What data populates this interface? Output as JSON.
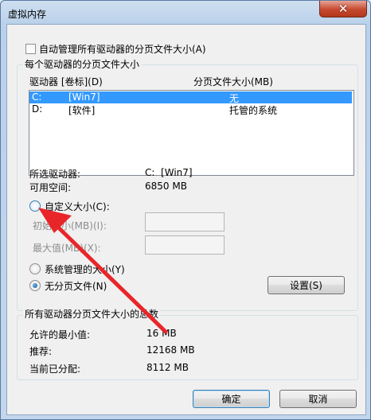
{
  "window": {
    "title": "虚拟内存",
    "close_glyph": "✕"
  },
  "auto_manage": {
    "label": "自动管理所有驱动器的分页文件大小(A)",
    "checked": false
  },
  "per_drive_group": {
    "label": "每个驱动器的分页文件大小",
    "col_drive": "驱动器 [卷标](D)",
    "col_size": "分页文件大小(MB)",
    "rows": [
      {
        "drive": "C:",
        "label": "[Win7]",
        "size": "无",
        "selected": true
      },
      {
        "drive": "D:",
        "label": "[软件]",
        "size": "托管的系统",
        "selected": false
      }
    ],
    "selected_drive_label": "所选驱动器:",
    "selected_drive_value": "C:  [Win7]",
    "free_space_label": "可用空间:",
    "free_space_value": "6850 MB",
    "custom_size_label": "自定义大小(C):",
    "initial_size_label": "初始大小(MB)(I):",
    "max_size_label": "最大值(MB)(X):",
    "system_managed_label": "系统管理的大小(Y)",
    "no_paging_label": "无分页文件(N)",
    "selected_option": "no_paging",
    "set_button": "设置(S)"
  },
  "total_group": {
    "label": "所有驱动器分页文件大小的总数",
    "min_label": "允许的最小值:",
    "min_value": "16 MB",
    "recommended_label": "推荐:",
    "recommended_value": "12168 MB",
    "allocated_label": "当前已分配:",
    "allocated_value": "8112 MB"
  },
  "buttons": {
    "ok": "确定",
    "cancel": "取消"
  },
  "annotation": {
    "arrow_color": "#e8262a"
  }
}
